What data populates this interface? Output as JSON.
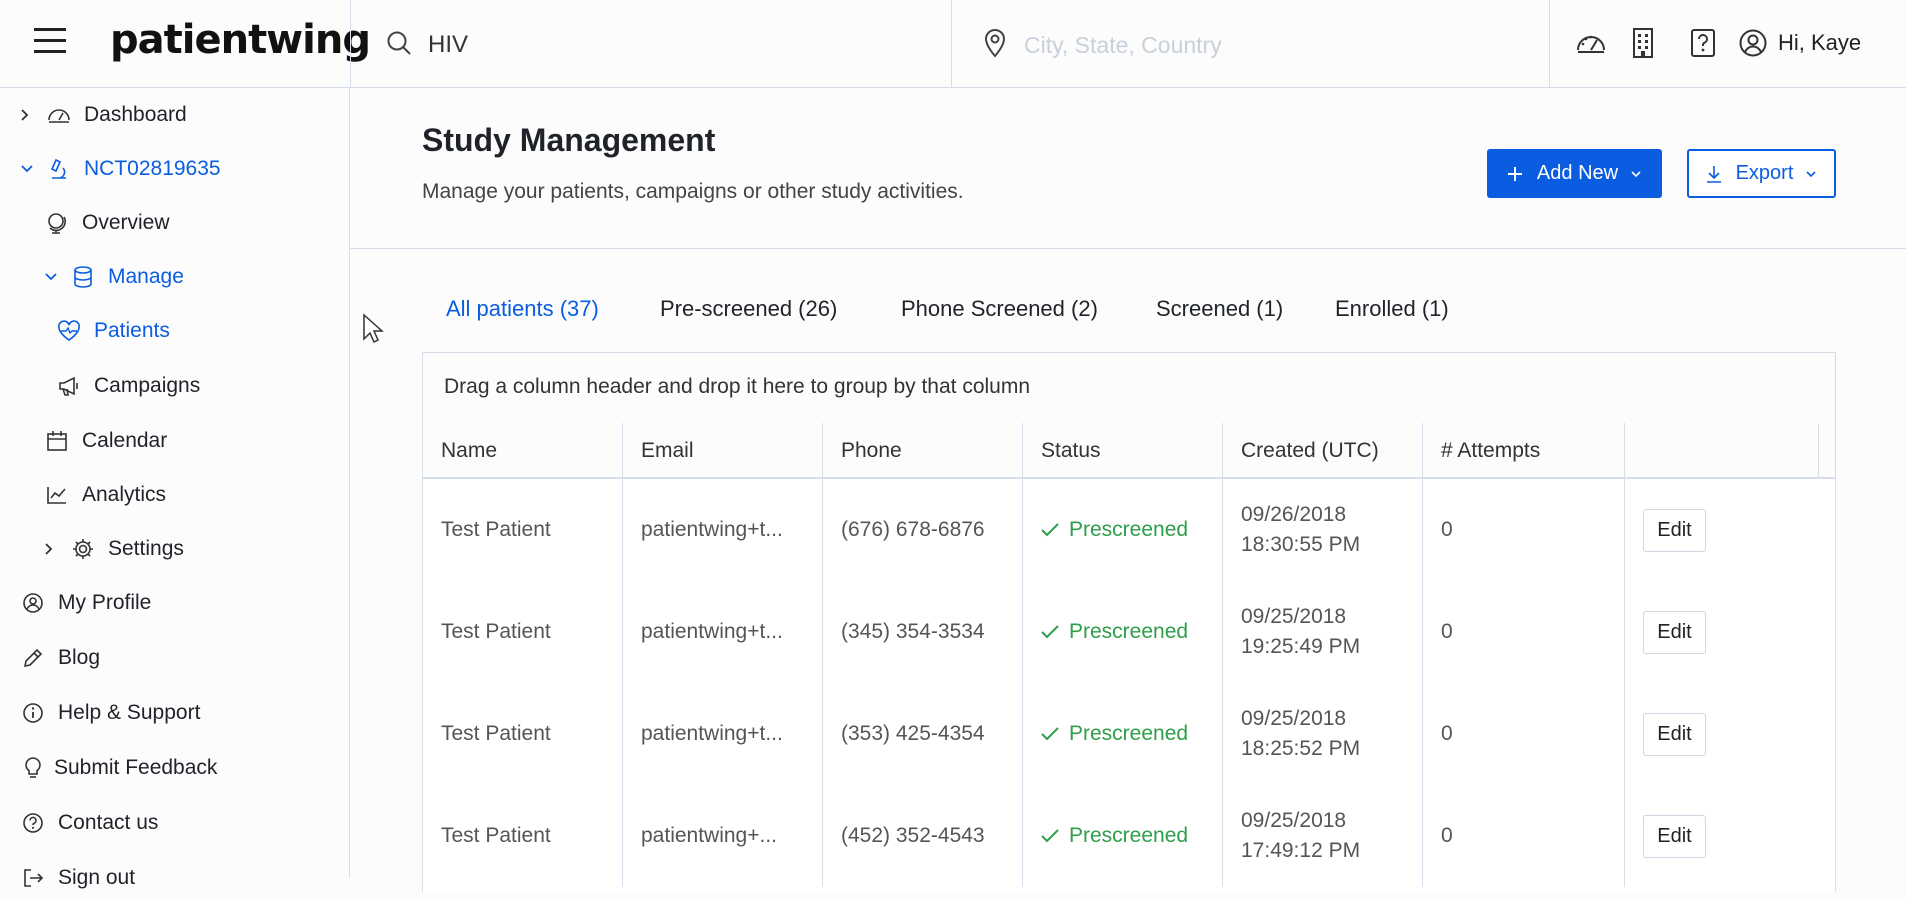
{
  "brand": {
    "logo_text": "patientwing"
  },
  "topbar": {
    "search_value": "HIV",
    "location_placeholder": "City, State, Country",
    "user_greeting": "Hi, Kaye"
  },
  "sidebar": {
    "items": [
      {
        "label": "Dashboard"
      },
      {
        "label": "NCT02819635"
      },
      {
        "label": "Overview"
      },
      {
        "label": "Manage"
      },
      {
        "label": "Patients"
      },
      {
        "label": "Campaigns"
      },
      {
        "label": "Calendar"
      },
      {
        "label": "Analytics"
      },
      {
        "label": "Settings"
      },
      {
        "label": "My Profile"
      },
      {
        "label": "Blog"
      },
      {
        "label": "Help & Support"
      },
      {
        "label": "Submit Feedback"
      },
      {
        "label": "Contact us"
      },
      {
        "label": "Sign out"
      }
    ]
  },
  "page": {
    "title": "Study Management",
    "subtitle": "Manage your patients, campaigns or other study activities.",
    "add_new_label": "Add New",
    "export_label": "Export"
  },
  "tabs": [
    {
      "label": "All patients (37)"
    },
    {
      "label": "Pre-screened (26)"
    },
    {
      "label": "Phone Screened (2)"
    },
    {
      "label": "Screened (1)"
    },
    {
      "label": "Enrolled (1)"
    }
  ],
  "grid": {
    "group_hint": "Drag a column header and drop it here to group by that column",
    "columns": [
      "Name",
      "Email",
      "Phone",
      "Status",
      "Created (UTC)",
      "# Attempts",
      ""
    ],
    "rows": [
      {
        "name": "Test Patient",
        "email": "patientwing+t...",
        "phone": "(676) 678-6876",
        "status": "Prescreened",
        "created_date": "09/26/2018",
        "created_time": "18:30:55 PM",
        "attempts": "0",
        "action": "Edit"
      },
      {
        "name": "Test Patient",
        "email": "patientwing+t...",
        "phone": "(345) 354-3534",
        "status": "Prescreened",
        "created_date": "09/25/2018",
        "created_time": "19:25:49 PM",
        "attempts": "0",
        "action": "Edit"
      },
      {
        "name": "Test Patient",
        "email": "patientwing+t...",
        "phone": "(353) 425-4354",
        "status": "Prescreened",
        "created_date": "09/25/2018",
        "created_time": "18:25:52 PM",
        "attempts": "0",
        "action": "Edit"
      },
      {
        "name": "Test Patient",
        "email": "patientwing+...",
        "phone": "(452) 352-4543",
        "status": "Prescreened",
        "created_date": "09/25/2018",
        "created_time": "17:49:12 PM",
        "attempts": "0",
        "action": "Edit"
      }
    ]
  },
  "colors": {
    "accent": "#0a5de0",
    "success": "#2e9e4a",
    "logo_dot": "#7ac142",
    "border": "#d5deea"
  }
}
